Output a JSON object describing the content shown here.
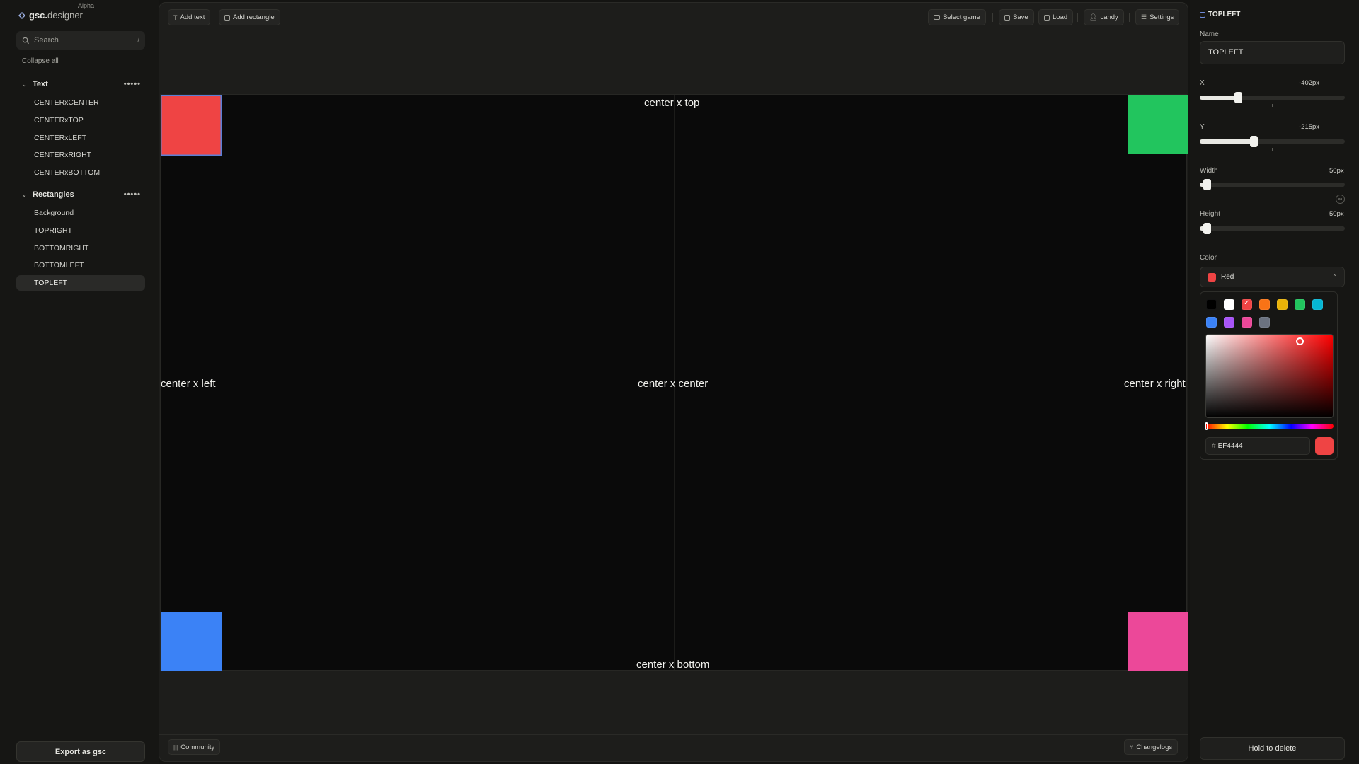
{
  "app": {
    "logo_bold": "gsc.",
    "logo_rest": "designer",
    "badge": "Alpha"
  },
  "sidebar": {
    "search_placeholder": "Search",
    "search_shortcut": "/",
    "collapse_all": "Collapse all",
    "groups": [
      {
        "label": "Text",
        "items": [
          "CENTERxCENTER",
          "CENTERxTOP",
          "CENTERxLEFT",
          "CENTERxRIGHT",
          "CENTERxBOTTOM"
        ]
      },
      {
        "label": "Rectangles",
        "items": [
          "Background",
          "TOPRIGHT",
          "BOTTOMRIGHT",
          "BOTTOMLEFT",
          "TOPLEFT"
        ]
      }
    ],
    "group_menu": "•••••",
    "active_item": "TOPLEFT",
    "export_label": "Export as gsc"
  },
  "toolbar": {
    "add_text": "Add text",
    "add_rectangle": "Add rectangle",
    "select_game": "Select game",
    "save": "Save",
    "load": "Load",
    "user": "candy",
    "settings": "Settings"
  },
  "canvas": {
    "texts": {
      "top": "center x top",
      "left": "center x left",
      "center": "center x center",
      "right": "center x right",
      "bottom": "center x bottom"
    },
    "colors": {
      "topleft": "#EF4444",
      "topright": "#22C55E",
      "bottomleft": "#3B82F6",
      "bottomright": "#EC4899"
    }
  },
  "footer": {
    "community": "Community",
    "changelogs": "Changelogs"
  },
  "panel": {
    "title": "TOPLEFT",
    "name_label": "Name",
    "name_value": "TOPLEFT",
    "x_label": "X",
    "x_value": "-402px",
    "y_label": "Y",
    "y_value": "-215px",
    "width_label": "Width",
    "width_value": "50px",
    "height_label": "Height",
    "height_value": "50px",
    "color_label": "Color",
    "color_value": "Red",
    "hex_value": "EF4444",
    "hex_prefix": "#",
    "swatches": [
      "#000000",
      "#FFFFFF",
      "#EF4444",
      "#F97316",
      "#EAB308",
      "#22C55E",
      "#06B6D4",
      "#3B82F6",
      "#A855F7",
      "#EC4899",
      "#6B7280"
    ],
    "selected_swatch": "#EF4444",
    "delete_label": "Hold to delete"
  }
}
